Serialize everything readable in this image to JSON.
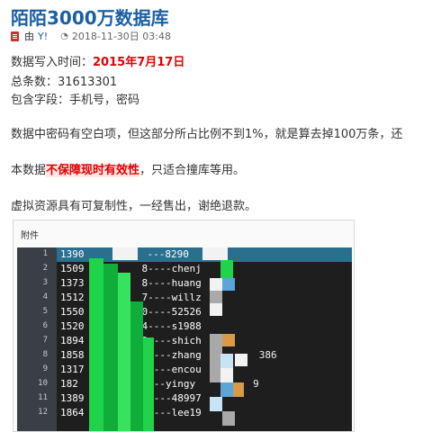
{
  "post": {
    "title": "陌陌3000万数据库",
    "by": "由",
    "author": "Y!",
    "datetime": "2018-11-30日 03:48"
  },
  "info": {
    "write_time_label": "数据写入时间：",
    "write_time_value": "2015年7月17日",
    "total_label": "总条数：",
    "total_value": "31613301",
    "fields_label": "包含字段：",
    "fields_value": "手机号，密码"
  },
  "notes": {
    "blank_password": "数据中密码有空白项，但这部分所占比例不到1%，就是算去掉100万条，还",
    "validity_prefix": "本数据",
    "validity_highlight": "不保障现时有效性",
    "validity_suffix": "，只适合撞库等用。",
    "refund": "虚拟资源具有可复制性，一经售出，谢绝退款。"
  },
  "attachment": {
    "label": "附件",
    "rows": [
      {
        "line": "1",
        "prefix": "1390",
        "suffix": "---8290"
      },
      {
        "line": "2",
        "prefix": "1509",
        "suffix": "8----chenj"
      },
      {
        "line": "3",
        "prefix": "1373",
        "suffix": "8----huang"
      },
      {
        "line": "4",
        "prefix": "1512",
        "suffix": "7----willz"
      },
      {
        "line": "5",
        "prefix": "1550",
        "suffix": "0----52526"
      },
      {
        "line": "6",
        "prefix": "1520",
        "suffix": "4----s1988"
      },
      {
        "line": "7",
        "prefix": "1894",
        "suffix": "9----shich"
      },
      {
        "line": "8",
        "prefix": "1858",
        "suffix": "8----zhang",
        "extra": "386"
      },
      {
        "line": "9",
        "prefix": "1317",
        "suffix": "8----encou"
      },
      {
        "line": "10",
        "prefix": "182",
        "suffix": "4----yingy",
        "extra": "9"
      },
      {
        "line": "11",
        "prefix": "1389",
        "suffix": "5----48997"
      },
      {
        "line": "12",
        "prefix": "1864",
        "suffix": "1----lee19"
      }
    ]
  },
  "icons": {
    "doc": "document-icon",
    "clock": "clock-icon"
  },
  "colors": {
    "title_blue": "#1b5fa3",
    "highlight_red": "#e00000",
    "editor_bg": "#1e1e1e",
    "mosaic_green": "#1fd34a"
  }
}
